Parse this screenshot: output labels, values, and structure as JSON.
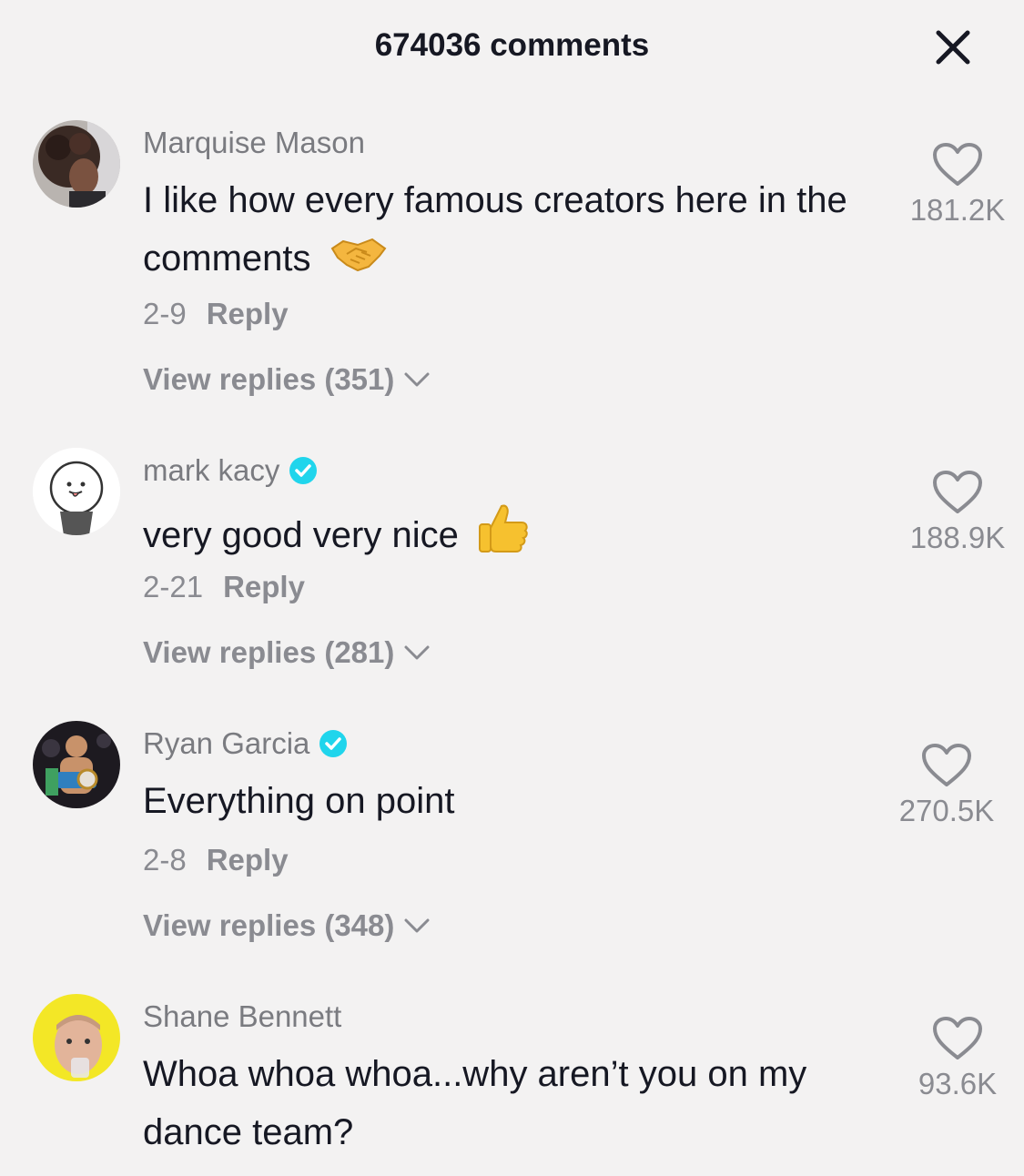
{
  "header": {
    "title": "674036 comments",
    "close_icon": "close-icon"
  },
  "colors": {
    "background": "#f3f2f2",
    "primary_text": "#161823",
    "secondary_text": "#8a8b91",
    "verified": "#20d5ec"
  },
  "comments": [
    {
      "username": "Marquise Mason",
      "verified": false,
      "text": "I like how every famous creators here in the comments",
      "emoji": "handshake-emoji",
      "date": "2-9",
      "reply_label": "Reply",
      "view_replies": "View replies (351)",
      "likes": "181.2K"
    },
    {
      "username": "mark kacy",
      "verified": true,
      "text": "very good very nice",
      "emoji": "thumbs-up-emoji",
      "date": "2-21",
      "reply_label": "Reply",
      "view_replies": "View replies (281)",
      "likes": "188.9K"
    },
    {
      "username": "Ryan Garcia",
      "verified": true,
      "text": "Everything on point",
      "emoji": "",
      "date": "2-8",
      "reply_label": "Reply",
      "view_replies": "View replies (348)",
      "likes": "270.5K"
    },
    {
      "username": "Shane Bennett",
      "verified": false,
      "text": "Whoa whoa whoa...why aren’t you on my dance team?",
      "emoji": "",
      "date": "",
      "reply_label": "",
      "view_replies": "",
      "likes": "93.6K"
    }
  ]
}
